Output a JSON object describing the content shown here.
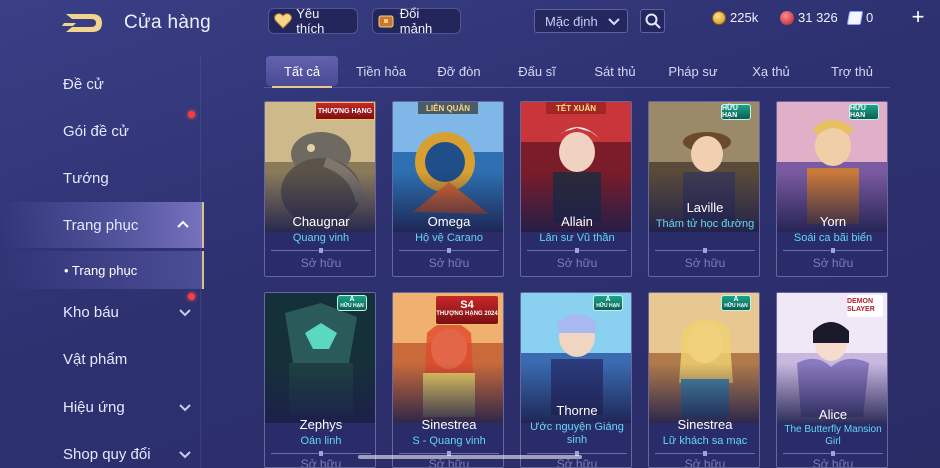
{
  "header": {
    "title": "Cửa hàng",
    "favorites_label": "Yêu thích",
    "fragments_label": "Đổi mảnh",
    "sort_value": "Mặc định",
    "currencies": {
      "gold": "225k",
      "voucher": "31 326",
      "gem": "0"
    },
    "plus_label": "+"
  },
  "sidebar": {
    "items": [
      {
        "label": "Đề cử"
      },
      {
        "label": "Gói đề cử"
      },
      {
        "label": "Tướng"
      },
      {
        "label": "Trang phục"
      },
      {
        "label": "Kho báu"
      },
      {
        "label": "Vật phẩm"
      },
      {
        "label": "Hiệu ứng"
      },
      {
        "label": "Shop quy đổi"
      }
    ],
    "sub_item": "• Trang phục"
  },
  "tabs": [
    {
      "label": "Tất cả"
    },
    {
      "label": "Tiền hỏa"
    },
    {
      "label": "Đỡ đòn"
    },
    {
      "label": "Đấu sĩ"
    },
    {
      "label": "Sát thủ"
    },
    {
      "label": "Pháp sư"
    },
    {
      "label": "Xạ thủ"
    },
    {
      "label": "Trợ thủ"
    }
  ],
  "cards": [
    {
      "hero": "Chaugnar",
      "skin": "Quang vinh",
      "status": "Sở hữu",
      "badge": "THƯỢNG HẠNG"
    },
    {
      "hero": "Omega",
      "skin": "Hộ vệ Carano",
      "status": "Sở hữu",
      "badge": "LIÊN QUÂN"
    },
    {
      "hero": "Allain",
      "skin": "Lân sư Vũ thần",
      "status": "Sở hữu",
      "badge": "TẾT XUÂN"
    },
    {
      "hero": "Laville",
      "skin": "Thám tử học đường",
      "status": "Sở hữu",
      "badge": "HỮU HẠN"
    },
    {
      "hero": "Yorn",
      "skin": "Soái ca bãi biển",
      "status": "Sở hữu",
      "badge": "HỮU HẠN"
    },
    {
      "hero": "Zephys",
      "skin": "Oán linh",
      "status": "Sở hữu",
      "badge": "A",
      "badge_sub": "HỮU HẠN"
    },
    {
      "hero": "Sinestrea",
      "skin": "S - Quang vinh",
      "status": "Sở hữu",
      "badge": "S4",
      "badge_sub": "THƯỢNG HẠNG 2024"
    },
    {
      "hero": "Thorne",
      "skin": "Ước nguyện Giáng sinh",
      "status": "Sở hữu",
      "badge": "A",
      "badge_sub": "HỮU HẠN"
    },
    {
      "hero": "Sinestrea",
      "skin": "Lữ khách sa mạc",
      "status": "Sở hữu",
      "badge": "A",
      "badge_sub": "HỮU HẠN"
    },
    {
      "hero": "Alice",
      "skin": "The Butterfly Mansion Girl",
      "status": "Sở hữu",
      "badge": "DEMON SLAYER"
    }
  ],
  "colors": {
    "accent_gold": "#e6c98a",
    "skin_name": "#63d6f2",
    "owned_text": "#7b7fb8"
  }
}
